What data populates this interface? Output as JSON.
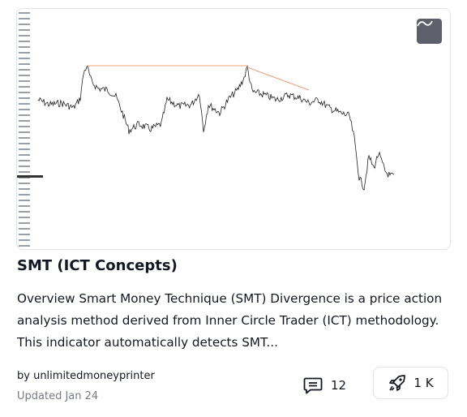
{
  "card": {
    "title": "SMT (ICT Concepts)",
    "description": "Overview Smart Money Technique (SMT) Divergence is a price action analysis method derived from Inner Circle Trader (ICT) methodology. This indicator automatically detects SMT...",
    "author": "by unlimitedmoneyprinter",
    "updated": "Updated Jan 24",
    "comments_count": "12",
    "boosts_count": "1 K",
    "icons": {
      "chart_toggle": "line-chart-icon",
      "comments": "comment-icon",
      "boosts": "rocket-icon"
    },
    "colors": {
      "accent_line": "#f0a07a",
      "price_line": "#222222",
      "button_bg": "#5d606b"
    }
  }
}
